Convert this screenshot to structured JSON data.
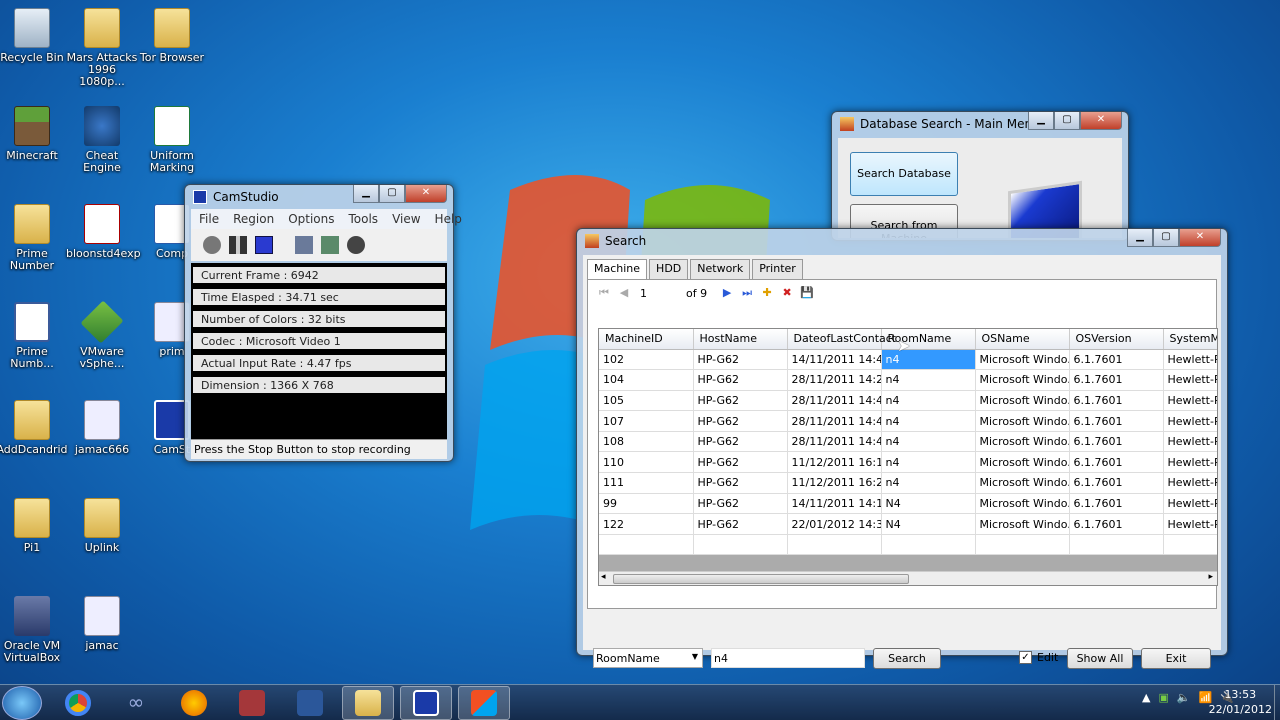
{
  "desktop_icons": [
    {
      "label": "Recycle Bin",
      "icon": "recycle-bin-icon"
    },
    {
      "label": "Mars Attacks 1996 1080p...",
      "icon": "folder-icon"
    },
    {
      "label": "Tor Browser",
      "icon": "folder-icon"
    },
    {
      "label": "Minecraft",
      "icon": "minecraft-icon"
    },
    {
      "label": "Cheat Engine",
      "icon": "cheat-engine-icon"
    },
    {
      "label": "Uniform Marking",
      "icon": "excel-file-icon"
    },
    {
      "label": "Prime Number",
      "icon": "folder-icon"
    },
    {
      "label": "bloonstd4exp",
      "icon": "swf-file-icon"
    },
    {
      "label": "Comp",
      "icon": "word-file-icon"
    },
    {
      "label": "Prime Numb...",
      "icon": "application-icon"
    },
    {
      "label": "VMware vSphe...",
      "icon": "vmware-icon"
    },
    {
      "label": "prim",
      "icon": "document-icon"
    },
    {
      "label": "AddDcandrid",
      "icon": "folder-icon"
    },
    {
      "label": "jamac666",
      "icon": "document-icon"
    },
    {
      "label": "CamSt",
      "icon": "camstudio-icon"
    },
    {
      "label": "Pi1",
      "icon": "folder-icon"
    },
    {
      "label": "Uplink",
      "icon": "folder-icon"
    },
    {
      "label": "Oracle VM VirtualBox",
      "icon": "virtualbox-icon"
    },
    {
      "label": "jamac",
      "icon": "document-icon"
    }
  ],
  "camstudio": {
    "title": "CamStudio",
    "menu": [
      "File",
      "Region",
      "Options",
      "Tools",
      "View",
      "Help"
    ],
    "info": [
      "Current Frame : 6942",
      "Time Elasped : 34.71 sec",
      "Number of Colors : 32 bits",
      "Codec : Microsoft Video 1",
      "Actual Input Rate : 4.47 fps",
      "Dimension : 1366 X 768"
    ],
    "status": "Press the Stop Button to stop recording"
  },
  "main_menu": {
    "title": "Database Search - Main Menu",
    "search_db": "Search Database",
    "search_machine": "Search from Machine"
  },
  "search": {
    "title": "Search",
    "tabs": [
      "Machine",
      "HDD",
      "Network",
      "Printer"
    ],
    "nav": {
      "position": "1",
      "of": "of 9"
    },
    "columns": [
      "MachineID",
      "HostName",
      "DateofLastContact",
      "RoomName",
      "OSName",
      "OSVersion",
      "SystemMa"
    ],
    "rows": [
      [
        "102",
        "HP-G62",
        "14/11/2011 14:4...",
        "n4",
        "Microsoft Windo...",
        "6.1.7601",
        "Hewlett-Pac"
      ],
      [
        "104",
        "HP-G62",
        "28/11/2011 14:2...",
        "n4",
        "Microsoft Windo...",
        "6.1.7601",
        "Hewlett-Pac"
      ],
      [
        "105",
        "HP-G62",
        "28/11/2011 14:4...",
        "n4",
        "Microsoft Windo...",
        "6.1.7601",
        "Hewlett-Pac"
      ],
      [
        "107",
        "HP-G62",
        "28/11/2011 14:4...",
        "n4",
        "Microsoft Windo...",
        "6.1.7601",
        "Hewlett-Pac"
      ],
      [
        "108",
        "HP-G62",
        "28/11/2011 14:4...",
        "n4",
        "Microsoft Windo...",
        "6.1.7601",
        "Hewlett-Pac"
      ],
      [
        "110",
        "HP-G62",
        "11/12/2011 16:1...",
        "n4",
        "Microsoft Windo...",
        "6.1.7601",
        "Hewlett-Pac"
      ],
      [
        "111",
        "HP-G62",
        "11/12/2011 16:2...",
        "n4",
        "Microsoft Windo...",
        "6.1.7601",
        "Hewlett-Pac"
      ],
      [
        "99",
        "HP-G62",
        "14/11/2011 14:1...",
        "N4",
        "Microsoft Windo...",
        "6.1.7601",
        "Hewlett-Pac"
      ],
      [
        "122",
        "HP-G62",
        "22/01/2012 14:3...",
        "N4",
        "Microsoft Windo...",
        "6.1.7601",
        "Hewlett-Pac"
      ]
    ],
    "field": "RoomName",
    "query": "n4",
    "search_btn": "Search",
    "edit_label": "Edit",
    "show_all": "Show All",
    "exit": "Exit"
  },
  "taskbar": {
    "time": "13:53",
    "date": "22/01/2012"
  }
}
